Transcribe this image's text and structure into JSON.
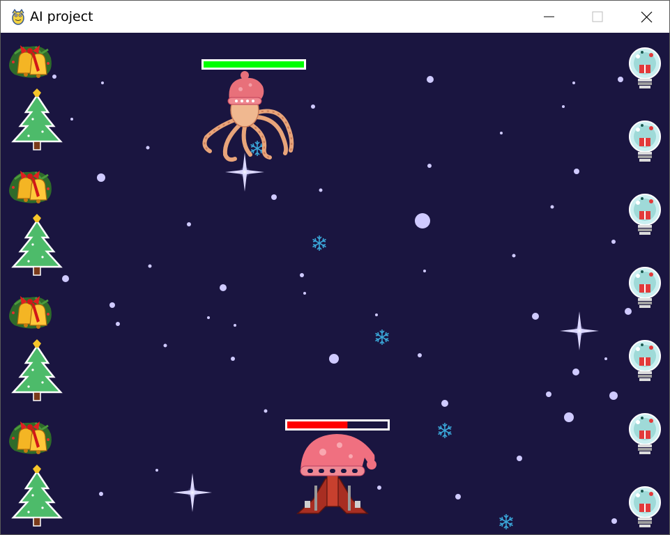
{
  "window": {
    "title": "AI project",
    "buttons": {
      "minimize": "minimize-icon",
      "maximize": "maximize-icon",
      "close": "close-icon"
    }
  },
  "game": {
    "background_color": "#1a1540",
    "enemy": {
      "sprite": "octopus-santa-hat",
      "health_fraction": 1.0,
      "health_color": "#00ff00"
    },
    "player": {
      "sprite": "red-ship-santa-hat",
      "health_fraction": 0.6,
      "health_color": "#ff0000"
    },
    "left_decorations": [
      "bells",
      "tree",
      "bells",
      "tree",
      "bells",
      "tree",
      "bells",
      "tree"
    ],
    "right_decorations": [
      "lightbulb",
      "lightbulb",
      "lightbulb",
      "lightbulb",
      "lightbulb",
      "lightbulb",
      "lightbulb"
    ],
    "projectile_icon": "snowflake-icon"
  }
}
